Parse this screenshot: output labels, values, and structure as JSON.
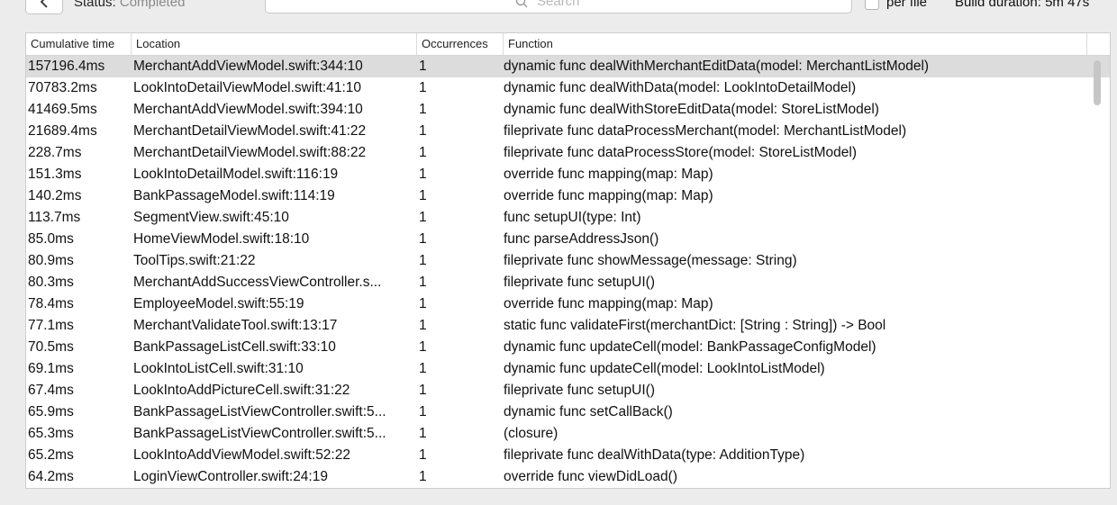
{
  "toolbar": {
    "status_label": "Status:",
    "status_value": "Completed",
    "search_placeholder": "Search",
    "per_file_label": "per file",
    "build_duration": "Build duration: 5m 47s"
  },
  "table": {
    "headers": [
      "Cumulative time",
      "Location",
      "Occurrences",
      "Function"
    ],
    "rows": [
      {
        "time": "157196.4ms",
        "location": "MerchantAddViewModel.swift:344:10",
        "occ": "1",
        "func": "dynamic func dealWithMerchantEditData(model: MerchantListModel)"
      },
      {
        "time": "70783.2ms",
        "location": "LookIntoDetailViewModel.swift:41:10",
        "occ": "1",
        "func": "dynamic func dealWithData(model: LookIntoDetailModel)"
      },
      {
        "time": "41469.5ms",
        "location": "MerchantAddViewModel.swift:394:10",
        "occ": "1",
        "func": "dynamic func dealWithStoreEditData(model: StoreListModel)"
      },
      {
        "time": "21689.4ms",
        "location": "MerchantDetailViewModel.swift:41:22",
        "occ": "1",
        "func": "fileprivate func dataProcessMerchant(model: MerchantListModel)"
      },
      {
        "time": "228.7ms",
        "location": "MerchantDetailViewModel.swift:88:22",
        "occ": "1",
        "func": "fileprivate func dataProcessStore(model: StoreListModel)"
      },
      {
        "time": "151.3ms",
        "location": "LookIntoDetailModel.swift:116:19",
        "occ": "1",
        "func": "override func mapping(map: Map)"
      },
      {
        "time": "140.2ms",
        "location": "BankPassageModel.swift:114:19",
        "occ": "1",
        "func": "override func mapping(map: Map)"
      },
      {
        "time": "113.7ms",
        "location": "SegmentView.swift:45:10",
        "occ": "1",
        "func": "func setupUI(type: Int)"
      },
      {
        "time": "85.0ms",
        "location": "HomeViewModel.swift:18:10",
        "occ": "1",
        "func": "func parseAddressJson()"
      },
      {
        "time": "80.9ms",
        "location": "ToolTips.swift:21:22",
        "occ": "1",
        "func": "fileprivate func showMessage(message: String)"
      },
      {
        "time": "80.3ms",
        "location": "MerchantAddSuccessViewController.s...",
        "occ": "1",
        "func": "fileprivate func setupUI()"
      },
      {
        "time": "78.4ms",
        "location": "EmployeeModel.swift:55:19",
        "occ": "1",
        "func": "override func mapping(map: Map)"
      },
      {
        "time": "77.1ms",
        "location": "MerchantValidateTool.swift:13:17",
        "occ": "1",
        "func": "static func validateFirst(merchantDict: [String : String]) -> Bool"
      },
      {
        "time": "70.5ms",
        "location": "BankPassageListCell.swift:33:10",
        "occ": "1",
        "func": "dynamic func updateCell(model: BankPassageConfigModel)"
      },
      {
        "time": "69.1ms",
        "location": "LookIntoListCell.swift:31:10",
        "occ": "1",
        "func": "dynamic func updateCell(model: LookIntoListModel)"
      },
      {
        "time": "67.4ms",
        "location": "LookIntoAddPictureCell.swift:31:22",
        "occ": "1",
        "func": "fileprivate func setupUI()"
      },
      {
        "time": "65.9ms",
        "location": "BankPassageListViewController.swift:5...",
        "occ": "1",
        "func": "dynamic func setCallBack()"
      },
      {
        "time": "65.3ms",
        "location": "BankPassageListViewController.swift:5...",
        "occ": "1",
        "func": "(closure)"
      },
      {
        "time": "65.2ms",
        "location": "LookIntoAddViewModel.swift:52:22",
        "occ": "1",
        "func": "fileprivate func dealWithData(type: AdditionType)"
      },
      {
        "time": "64.2ms",
        "location": "LoginViewController.swift:24:19",
        "occ": "1",
        "func": "override func viewDidLoad()"
      }
    ]
  }
}
